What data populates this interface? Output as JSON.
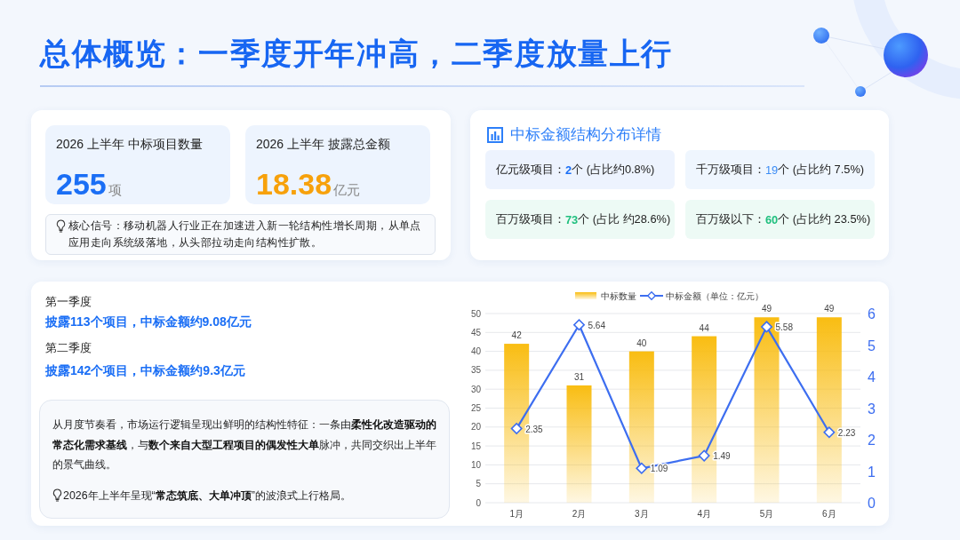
{
  "title": "总体概览：一季度开年冲高，二季度放量上行",
  "overview": {
    "stats": [
      {
        "label": "2026 上半年 中标项目数量",
        "value": "255",
        "unit": "项",
        "color": "#1a6ef5"
      },
      {
        "label": "2026 上半年 披露总金额",
        "value": "18.38",
        "unit": "亿元",
        "color": "#f7a10b"
      }
    ],
    "signal": "核心信号：移动机器人行业正在加速进入新一轮结构性增长周期，从单点应用走向系统级落地，从头部拉动走向结构性扩散。"
  },
  "structure": {
    "title": "中标金额结构分布详情",
    "items": [
      {
        "label": "亿元级项目：",
        "count": "2",
        "detail": "个 (占比约0.8%)",
        "color": "#1a6ef5",
        "bold": true
      },
      {
        "label": "千万级项目：",
        "count": "19",
        "detail": "个 (占比约 7.5%)",
        "color": "#3b8cf5",
        "bold": false
      },
      {
        "label": "百万级项目：",
        "count": "73",
        "detail": "个 (占比 约28.6%)",
        "color": "#1fbf7e",
        "bold": true
      },
      {
        "label": "百万级以下：",
        "count": "60",
        "detail": "个 (占比约 23.5%)",
        "color": "#1fbf7e",
        "bold": true
      }
    ]
  },
  "quarters": [
    {
      "label": "第一季度",
      "summary": "披露113个项目，中标金额约9.08亿元"
    },
    {
      "label": "第二季度",
      "summary": "披露142个项目，中标金额约9.3亿元"
    }
  ],
  "analysis": {
    "paragraph": "从月度节奏看，市场运行逻辑呈现出鲜明的结构性特征：一条由**柔性化改造驱动的常态化需求基线**，与**数个来自大型工程项目的偶发性大单**脉冲，共同交织出上半年的景气曲线。",
    "tip": "2026年上半年呈现“**常态筑底、大单冲顶**”的波浪式上行格局。"
  },
  "chart": {
    "chart_data": {
      "type": "bar",
      "categories": [
        "1月",
        "2月",
        "3月",
        "4月",
        "5月",
        "6月"
      ],
      "series": [
        {
          "name": "中标数量",
          "color": "#f9bd12",
          "values": [
            42,
            31,
            40,
            44,
            49,
            49
          ]
        },
        {
          "name": "中标金额（单位：亿元）",
          "type": "line",
          "axis": "y2",
          "marker": "diamond",
          "color": "#3d6ef0",
          "values": [
            2.35,
            5.64,
            1.09,
            1.49,
            5.58,
            2.23
          ]
        }
      ],
      "ylim": [
        0,
        50
      ],
      "yticks": [
        0,
        5,
        10,
        15,
        20,
        25,
        30,
        35,
        40,
        45,
        50
      ],
      "y2lim": [
        0,
        6
      ],
      "y2ticks": [
        0,
        1,
        2,
        3,
        4,
        5,
        6
      ],
      "grid": true,
      "legend": "top",
      "data_labels": true
    }
  }
}
